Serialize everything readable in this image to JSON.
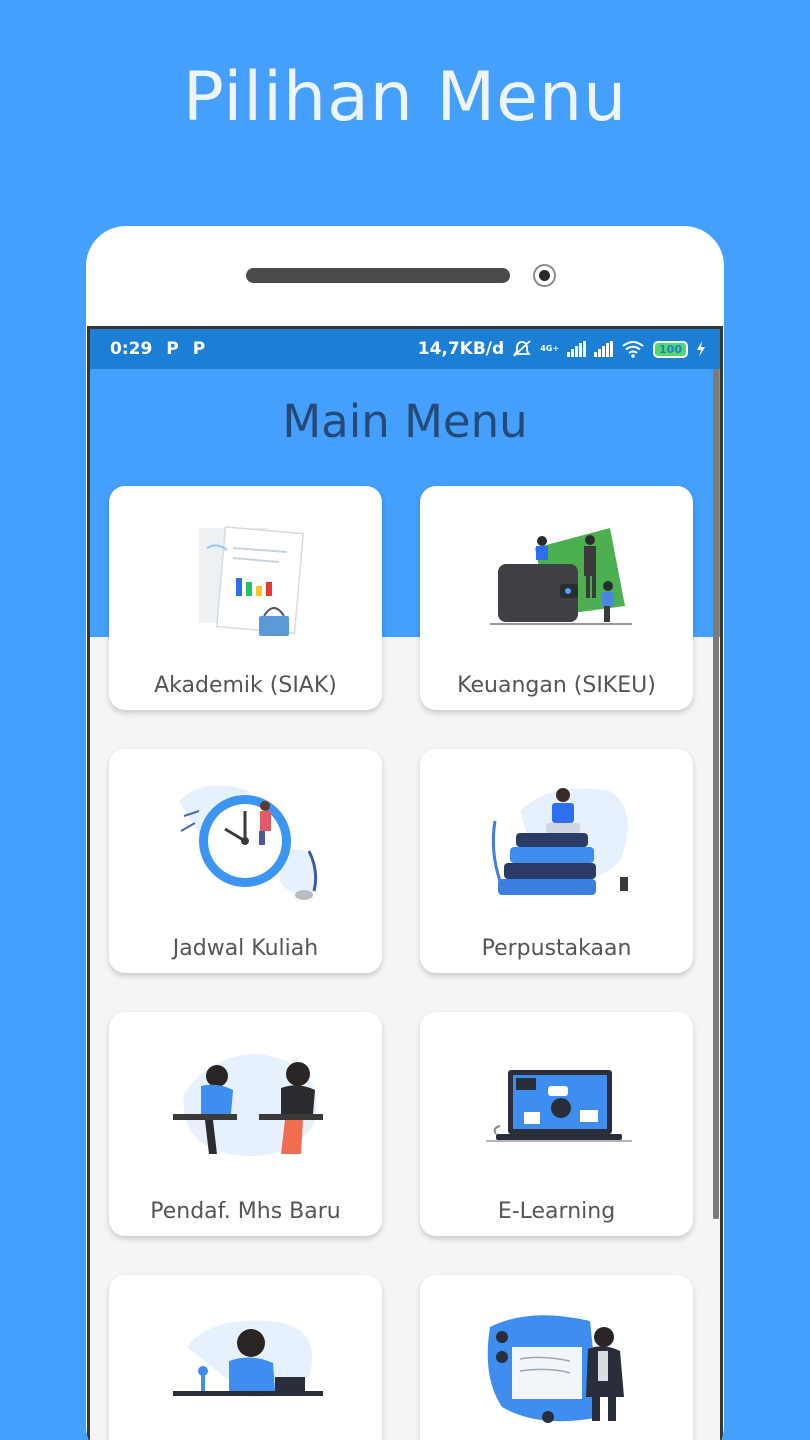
{
  "header": {
    "title": "Pilihan Menu"
  },
  "status_bar": {
    "time": "0:29",
    "notif_icons": [
      "P",
      "P"
    ],
    "speed": "14,7KB/d",
    "network_label": "4G+",
    "battery": "100"
  },
  "app": {
    "title": "Main Menu"
  },
  "menu": [
    {
      "label": "Akademik (SIAK)",
      "icon": "document-chart-icon"
    },
    {
      "label": "Keuangan (SIKEU)",
      "icon": "wallet-icon"
    },
    {
      "label": "Jadwal Kuliah",
      "icon": "clock-icon"
    },
    {
      "label": "Perpustakaan",
      "icon": "books-icon"
    },
    {
      "label": "Pendaf. Mhs Baru",
      "icon": "students-icon"
    },
    {
      "label": "E-Learning",
      "icon": "laptop-icon"
    },
    {
      "label": "",
      "icon": "operator-icon"
    },
    {
      "label": "",
      "icon": "presentation-icon"
    }
  ],
  "colors": {
    "background": "#449ffd",
    "status_bar": "#1b7fd6",
    "title": "#264a77"
  }
}
